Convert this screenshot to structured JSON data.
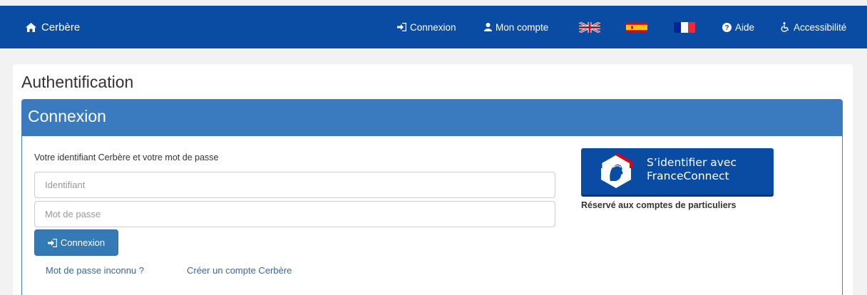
{
  "header": {
    "brand": "Cerbère",
    "nav": {
      "login": "Connexion",
      "account": "Mon compte",
      "help": "Aide",
      "accessibility": "Accessibilité"
    },
    "flags": [
      "uk-flag",
      "spain-flag",
      "france-flag"
    ],
    "colors": {
      "bar": "#0a4ca3"
    }
  },
  "page": {
    "title": "Authentification",
    "panel_title": "Connexion",
    "form": {
      "label": "Votre identifiant Cerbère et votre mot de passe",
      "username_placeholder": "Identifiant",
      "password_placeholder": "Mot de passe",
      "submit_label": "Connexion",
      "forgot_link": "Mot de passe inconnu ?",
      "create_link": "Créer un compte Cerbère"
    },
    "franceconnect": {
      "line1": "S’identifier avec",
      "line2": "FranceConnect",
      "note": "Réservé aux comptes de particuliers"
    },
    "colors": {
      "panel_heading": "#3a7bbf",
      "button": "#337ab7",
      "link": "#2a6ab3"
    }
  }
}
